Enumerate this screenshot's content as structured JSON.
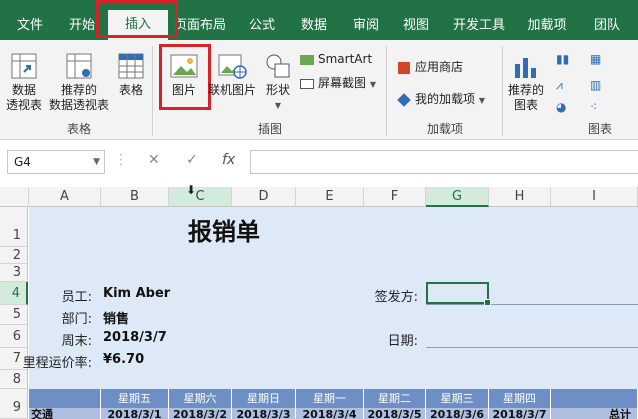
{
  "ribbon_tabs": [
    "文件",
    "开始",
    "插入",
    "页面布局",
    "公式",
    "数据",
    "审阅",
    "视图",
    "开发工具",
    "加载项",
    "团队"
  ],
  "ribbon": {
    "pivot_table": "数据\n透视表",
    "recommended_pivot": "推荐的\n数据透视表",
    "table": "表格",
    "picture": "图片",
    "online_picture": "联机图片",
    "shapes": "形状",
    "smartart": "SmartArt",
    "screenshot": "屏幕截图",
    "app_store": "应用商店",
    "my_addins": "我的加载项",
    "recommended_charts": "推荐的\n图表",
    "group_tables": "表格",
    "group_illustrations": "插图",
    "group_addins": "加载项",
    "group_charts": "图表"
  },
  "formula_bar": {
    "name_box": "G4",
    "cancel": "✕",
    "enter": "✓",
    "fx": "fx",
    "formula": ""
  },
  "columns": [
    "A",
    "B",
    "C",
    "D",
    "E",
    "F",
    "G",
    "H",
    "I"
  ],
  "rows": [
    "1",
    "2",
    "3",
    "4",
    "5",
    "6",
    "7",
    "8",
    "9"
  ],
  "selected_cell": "G4",
  "sheet": {
    "title": "报销单",
    "employee_label": "员工:",
    "employee": "Kim Aber",
    "dept_label": "部门:",
    "dept": "销售",
    "week_label": "周末:",
    "week": "2018/3/7",
    "mileage_label": "里程运价率:",
    "mileage": "¥6.70",
    "issuer_label": "签发方:",
    "date_label": "日期:",
    "days": [
      "星期五",
      "星期六",
      "星期日",
      "星期一",
      "星期二",
      "星期三",
      "星期四"
    ],
    "dates": [
      "2018/3/1",
      "2018/3/2",
      "2018/3/3",
      "2018/3/4",
      "2018/3/5",
      "2018/3/6",
      "2018/3/7"
    ],
    "row9_a": "交通",
    "total": "总计"
  }
}
